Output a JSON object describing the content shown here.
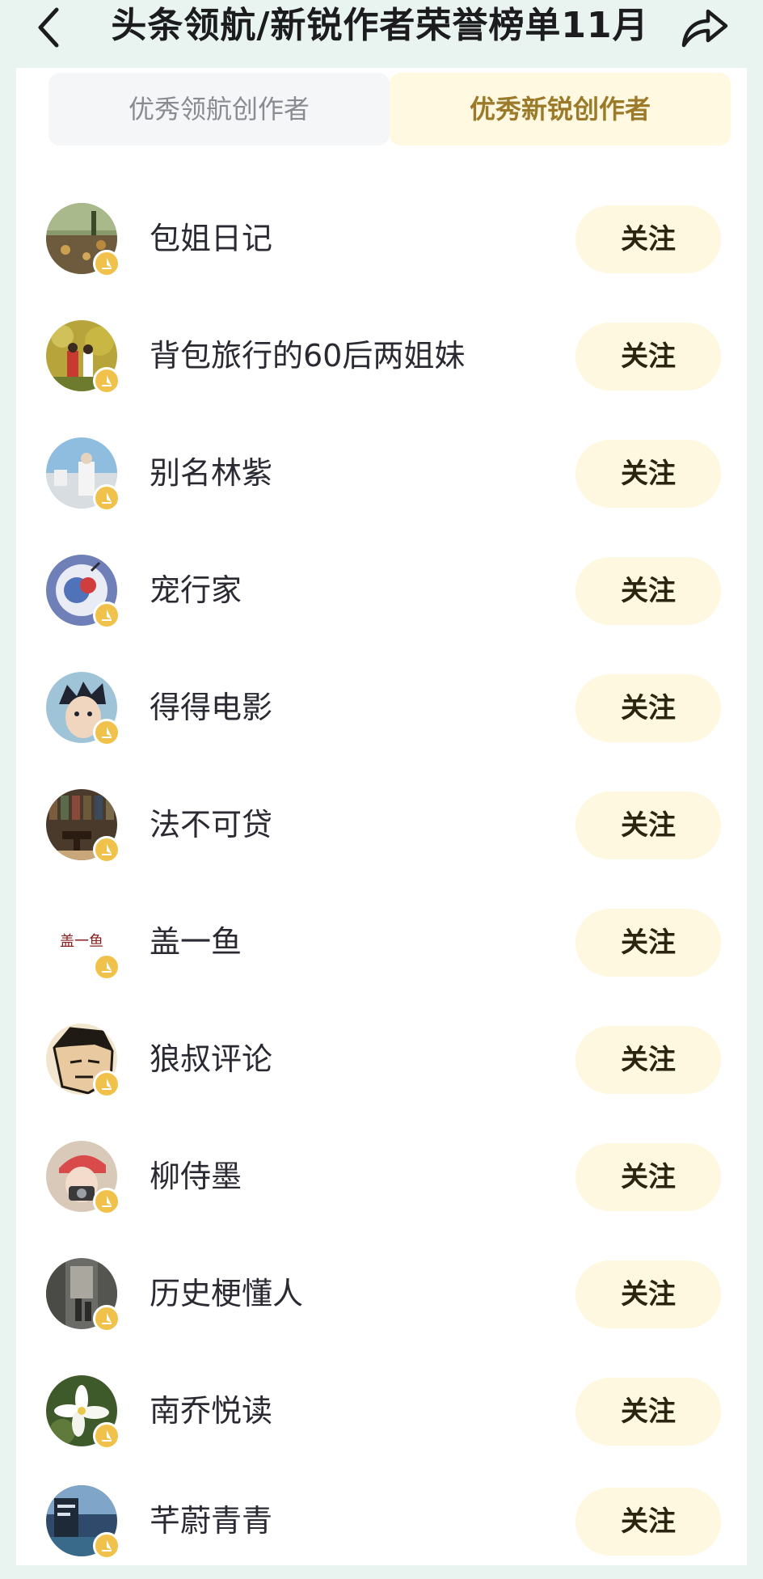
{
  "header": {
    "title": "头条领航/新锐作者荣誉榜单11月",
    "back_icon": "chevron-left-icon",
    "share_icon": "share-icon"
  },
  "tabs": [
    {
      "label": "优秀领航创作者",
      "active": false
    },
    {
      "label": "优秀新锐创作者",
      "active": true
    }
  ],
  "follow_label": "关注",
  "authors": [
    {
      "name": "包姐日记"
    },
    {
      "name": "背包旅行的60后两姐妹"
    },
    {
      "name": "别名林紫"
    },
    {
      "name": "宠行家"
    },
    {
      "name": "得得电影"
    },
    {
      "name": "法不可贷"
    },
    {
      "name": "盖一鱼",
      "avatar_text": "盖一鱼"
    },
    {
      "name": "狼叔评论"
    },
    {
      "name": "柳侍墨"
    },
    {
      "name": "历史梗懂人"
    },
    {
      "name": "南乔悦读"
    },
    {
      "name": "芊蔚青青"
    }
  ],
  "colors": {
    "background": "#e9f4f1",
    "active_tab_bg": "#fff9e2",
    "active_tab_text": "#9b7a2a",
    "follow_bg": "#fff8e0",
    "badge": "#f1c24b"
  }
}
